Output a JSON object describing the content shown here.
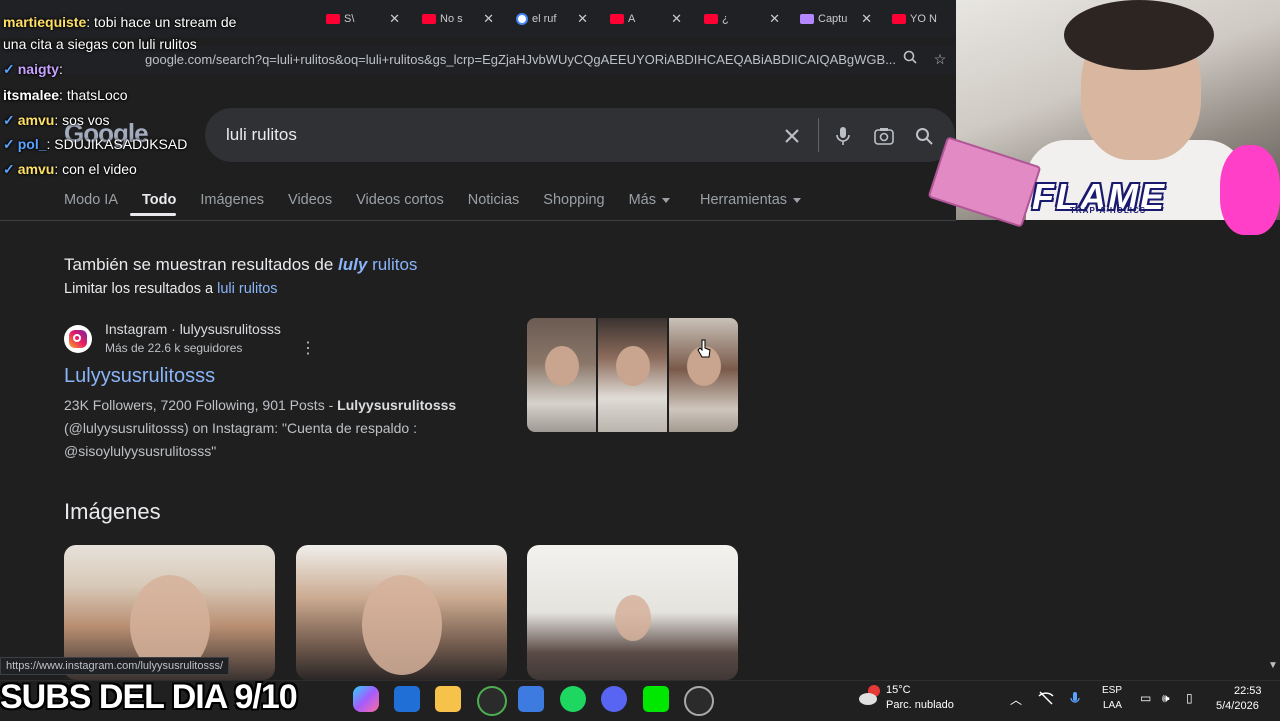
{
  "browser": {
    "tabs": [
      {
        "label": "S\\",
        "kind": "youtube"
      },
      {
        "label": "No s",
        "kind": "youtube"
      },
      {
        "label": "el ruf",
        "kind": "google"
      },
      {
        "label": "A",
        "kind": "youtube"
      },
      {
        "label": "¿",
        "kind": "youtube"
      },
      {
        "label": "Captu",
        "kind": "other"
      },
      {
        "label": "YO N",
        "kind": "youtube"
      }
    ],
    "url": "google.com/search?q=luli+rulitos&oq=luli+rulitos&gs_lcrp=EgZjaHJvbWUyCQgAEEUYORiABDIHCAEQABiABDIICAIQABgWGB..."
  },
  "search": {
    "query": "luli rulitos",
    "logo": "Google",
    "tabs": [
      {
        "label": "Modo IA",
        "active": false,
        "dropdown": false
      },
      {
        "label": "Todo",
        "active": true,
        "dropdown": false
      },
      {
        "label": "Imágenes",
        "active": false,
        "dropdown": false
      },
      {
        "label": "Videos",
        "active": false,
        "dropdown": false
      },
      {
        "label": "Videos cortos",
        "active": false,
        "dropdown": false
      },
      {
        "label": "Noticias",
        "active": false,
        "dropdown": false
      },
      {
        "label": "Shopping",
        "active": false,
        "dropdown": false
      },
      {
        "label": "Más",
        "active": false,
        "dropdown": true
      },
      {
        "label": "Herramientas",
        "active": false,
        "dropdown": true
      }
    ]
  },
  "spelling": {
    "prefix": "También se muestran resultados de ",
    "corrected_bold": "luly",
    "corrected_rest": " rulitos",
    "restrict_prefix": "Limitar los resultados a ",
    "restrict_link": "luli rulitos"
  },
  "result": {
    "site": "Instagram · lulyysusrulitosss",
    "meta": "Más de 22.6 k seguidores",
    "title": "Lulyysusrulitosss",
    "snippet_plain1": "23K Followers, 7200 Following, 901 Posts - ",
    "snippet_bold": "Lulyysusrulitosss",
    "snippet_plain2": "(@lulyysusrulitosss) on Instagram: \"Cuenta de respaldo : @sisoylulyysusrulitosss\""
  },
  "images_heading": "Imágenes",
  "status_url": "https://www.instagram.com/lulyysusrulitosss/",
  "chat": [
    {
      "user": "martiequiste",
      "message": "tobi hace un stream de",
      "color": "#ffe066"
    },
    {
      "user": "",
      "message": "una cita a siegas con luli rulitos",
      "color": "#ffffff"
    },
    {
      "user": "naigty",
      "message": ":",
      "color": "#c8a2ff"
    },
    {
      "user": "itsmalee",
      "message": "thatsLoco",
      "color": "#ffffff"
    },
    {
      "user": "amvu",
      "message": "sos vos",
      "color": "#ffe066"
    },
    {
      "user": "pol_",
      "message": "SDUJIKASADJKSAD",
      "color": "#5aa2ff"
    },
    {
      "user": "amvu",
      "message": "con el video",
      "color": "#ffe066"
    }
  ],
  "overlay": {
    "subs": "SUBS DEL DIA 9/10",
    "flame": "FLAME",
    "flame_sub": "TRAP-A-HOLICS"
  },
  "taskbar": {
    "weather_temp": "15°C",
    "weather_desc": "Parc. nublado",
    "weather_badge": "1",
    "lang_top": "ESP",
    "lang_bottom": "LAA",
    "time": "22:53",
    "date": "5/4/2026"
  }
}
